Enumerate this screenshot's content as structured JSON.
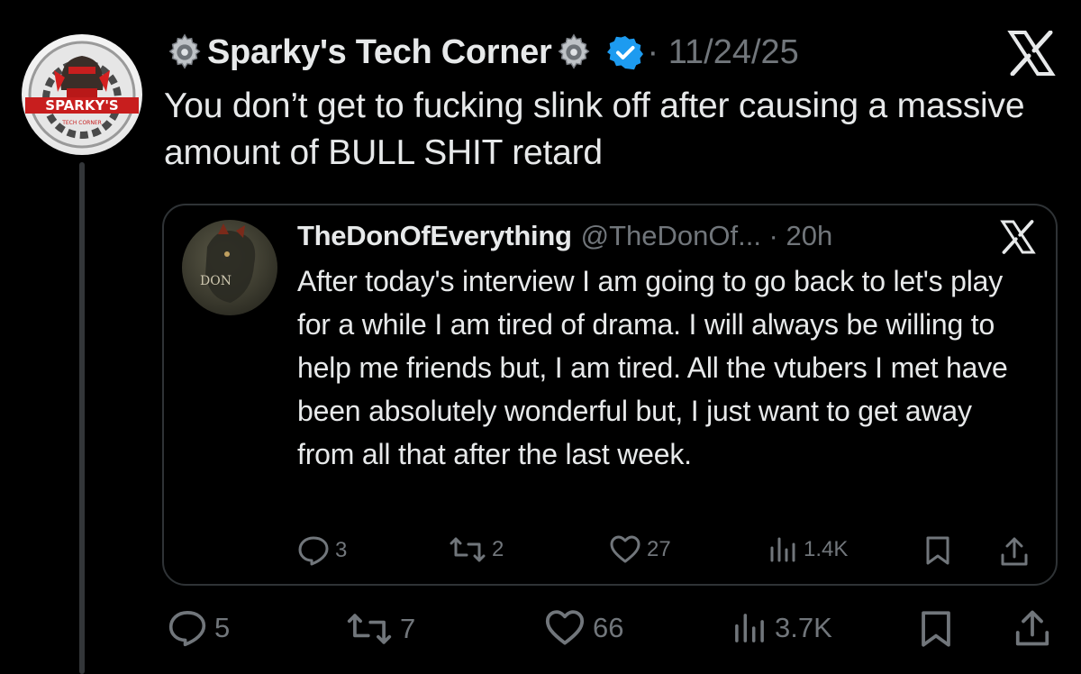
{
  "main_tweet": {
    "author_name": "Sparky's Tech Corner",
    "meta": "· 11/24/25",
    "text": "You don’t get to fucking slink off after causing a massive amount of BULL SHIT retard",
    "avatar_text": "SPARKY'S",
    "avatar_subtext": "TECH CORNER",
    "actions": {
      "replies": "5",
      "reposts": "7",
      "likes": "66",
      "views": "3.7K"
    }
  },
  "quoted_tweet": {
    "author_name": "TheDonOfEverything",
    "handle_meta": "@TheDonOf... · 20h",
    "avatar_text": "DON",
    "text": "After today's interview I am going to go back to let's play for a while I am tired of drama. I will always be willing to help me friends but, I am tired. All the vtubers I met have been absolutely wonderful but, I just want to get away from all that after the last week.",
    "actions": {
      "replies": "3",
      "reposts": "2",
      "likes": "27",
      "views": "1.4K"
    }
  },
  "colors": {
    "background": "#000000",
    "text": "#e7e9ea",
    "muted": "#71767b",
    "verified": "#1d9bf0",
    "border": "#2f3336"
  },
  "icons": [
    "gear-icon",
    "verified-badge-icon",
    "x-logo-icon",
    "reply-icon",
    "repost-icon",
    "like-icon",
    "views-icon",
    "bookmark-icon",
    "share-icon"
  ]
}
